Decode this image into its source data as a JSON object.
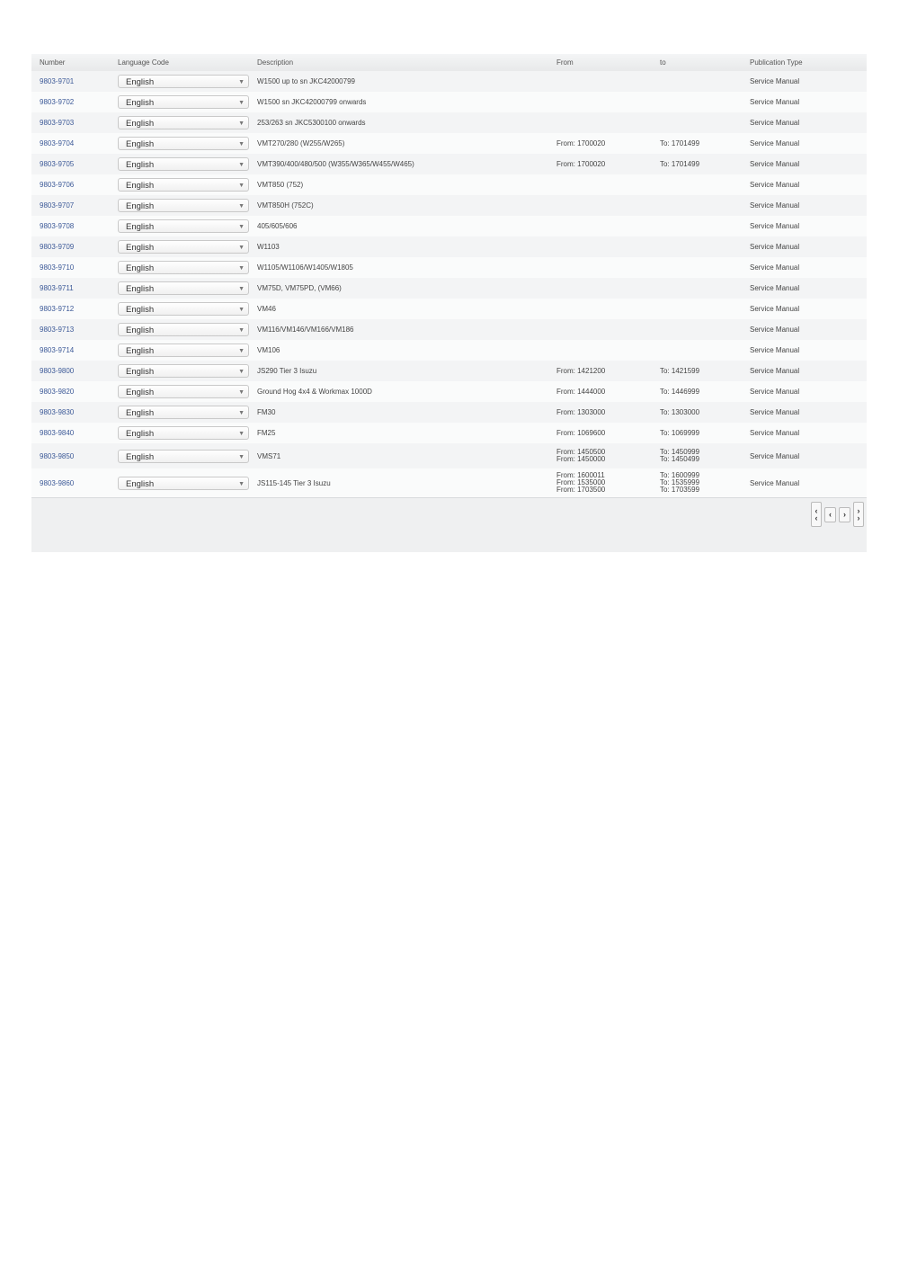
{
  "columns": [
    "Number",
    "Language Code",
    "Description",
    "From",
    "to",
    "Publication Type"
  ],
  "rows": [
    {
      "number": "9803-9701",
      "language": "English",
      "description": "W1500 up to sn JKC42000799",
      "from": [],
      "to": [],
      "type": "Service Manual"
    },
    {
      "number": "9803-9702",
      "language": "English",
      "description": "W1500 sn JKC42000799 onwards",
      "from": [],
      "to": [],
      "type": "Service Manual"
    },
    {
      "number": "9803-9703",
      "language": "English",
      "description": "253/263 sn JKC5300100 onwards",
      "from": [],
      "to": [],
      "type": "Service Manual"
    },
    {
      "number": "9803-9704",
      "language": "English",
      "description": "VMT270/280 (W255/W265)",
      "from": [
        "From: 1700020"
      ],
      "to": [
        "To: 1701499"
      ],
      "type": "Service Manual"
    },
    {
      "number": "9803-9705",
      "language": "English",
      "description": "VMT390/400/480/500 (W355/W365/W455/W465)",
      "from": [
        "From: 1700020"
      ],
      "to": [
        "To: 1701499"
      ],
      "type": "Service Manual"
    },
    {
      "number": "9803-9706",
      "language": "English",
      "description": "VMT850 (752)",
      "from": [],
      "to": [],
      "type": "Service Manual"
    },
    {
      "number": "9803-9707",
      "language": "English",
      "description": "VMT850H (752C)",
      "from": [],
      "to": [],
      "type": "Service Manual"
    },
    {
      "number": "9803-9708",
      "language": "English",
      "description": "405/605/606",
      "from": [],
      "to": [],
      "type": "Service Manual"
    },
    {
      "number": "9803-9709",
      "language": "English",
      "description": "W1103",
      "from": [],
      "to": [],
      "type": "Service Manual"
    },
    {
      "number": "9803-9710",
      "language": "English",
      "description": "W1105/W1106/W1405/W1805",
      "from": [],
      "to": [],
      "type": "Service Manual"
    },
    {
      "number": "9803-9711",
      "language": "English",
      "description": "VM75D, VM75PD, (VM66)",
      "from": [],
      "to": [],
      "type": "Service Manual"
    },
    {
      "number": "9803-9712",
      "language": "English",
      "description": "VM46",
      "from": [],
      "to": [],
      "type": "Service Manual"
    },
    {
      "number": "9803-9713",
      "language": "English",
      "description": "VM116/VM146/VM166/VM186",
      "from": [],
      "to": [],
      "type": "Service Manual"
    },
    {
      "number": "9803-9714",
      "language": "English",
      "description": "VM106",
      "from": [],
      "to": [],
      "type": "Service Manual"
    },
    {
      "number": "9803-9800",
      "language": "English",
      "description": "JS290 Tier 3 Isuzu",
      "from": [
        "From: 1421200"
      ],
      "to": [
        "To: 1421599"
      ],
      "type": "Service Manual"
    },
    {
      "number": "9803-9820",
      "language": "English",
      "description": "Ground Hog 4x4 & Workmax 1000D",
      "from": [
        "From: 1444000"
      ],
      "to": [
        "To: 1446999"
      ],
      "type": "Service Manual"
    },
    {
      "number": "9803-9830",
      "language": "English",
      "description": "FM30",
      "from": [
        "From: 1303000"
      ],
      "to": [
        "To: 1303000"
      ],
      "type": "Service Manual"
    },
    {
      "number": "9803-9840",
      "language": "English",
      "description": "FM25",
      "from": [
        "From: 1069600"
      ],
      "to": [
        "To: 1069999"
      ],
      "type": "Service Manual"
    },
    {
      "number": "9803-9850",
      "language": "English",
      "description": "VMS71",
      "from": [
        "From: 1450500",
        "From: 1450000"
      ],
      "to": [
        "To: 1450999",
        "To: 1450499"
      ],
      "type": "Service Manual"
    },
    {
      "number": "9803-9860",
      "language": "English",
      "description": "JS115-145 Tier 3 Isuzu",
      "from": [
        "From: 1600011",
        "From: 1535000",
        "From: 1703500"
      ],
      "to": [
        "To: 1600999",
        "To: 1535999",
        "To: 1703599"
      ],
      "type": "Service Manual"
    }
  ],
  "pager": {
    "first": "first-page-icon",
    "prev": "prev-page-icon",
    "next": "next-page-icon",
    "last": "last-page-icon"
  },
  "colors": {
    "link": "#3d5a98",
    "panel": "#eff0f1"
  }
}
